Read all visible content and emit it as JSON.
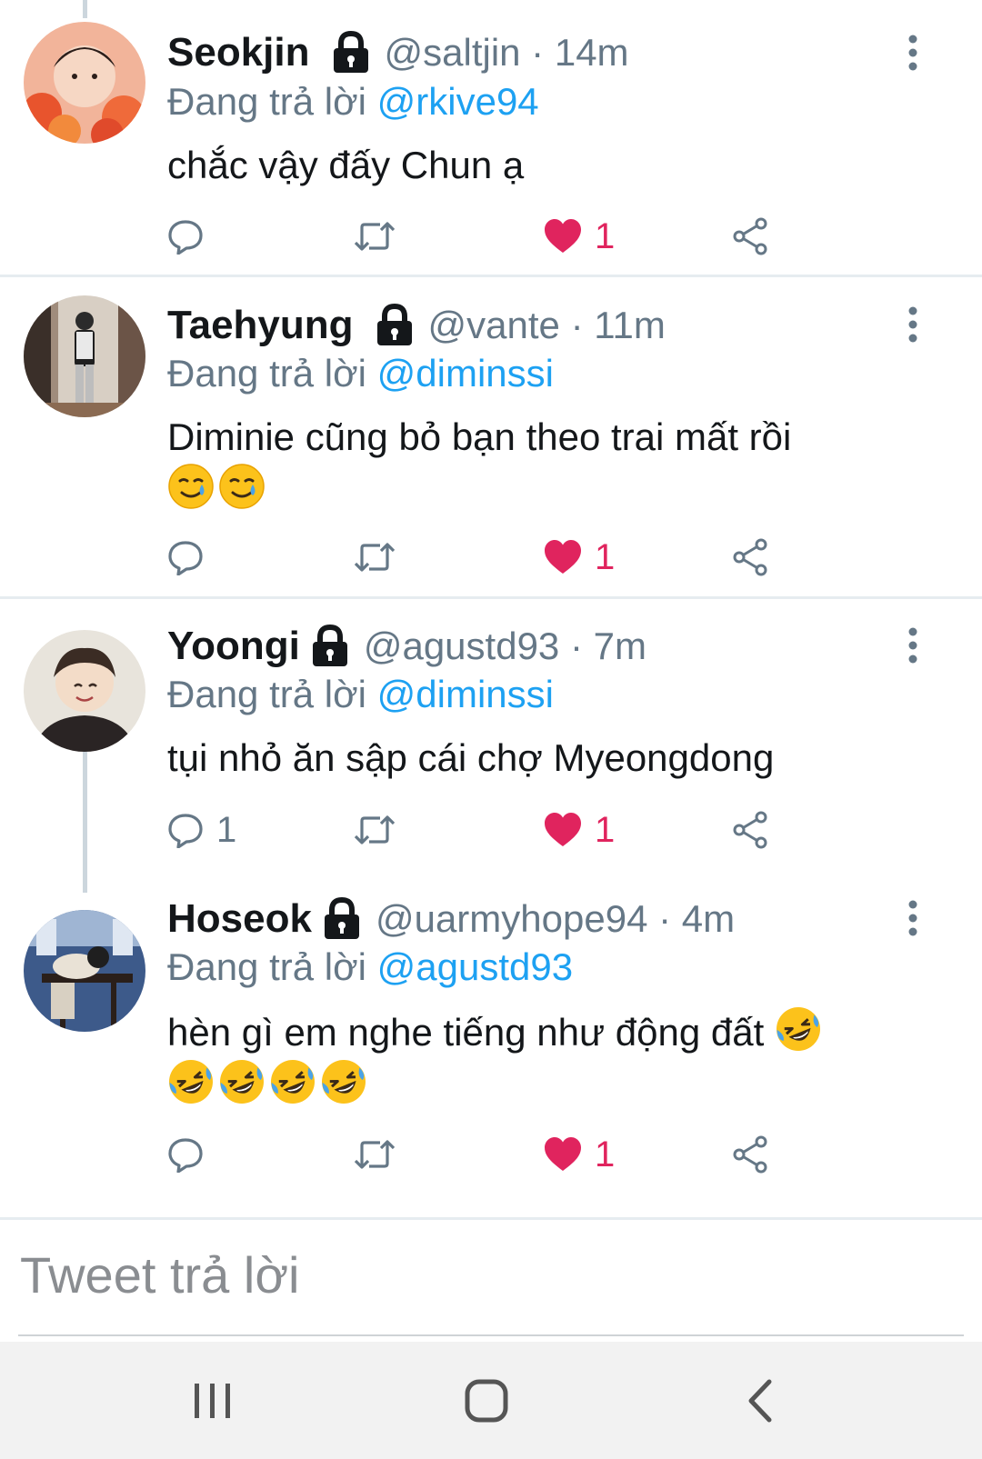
{
  "tweets": [
    {
      "name": "Seokjin",
      "handle": "@saltjin · 14m",
      "replying_prefix": "Đang trả lời",
      "replying_to": "@rkive94",
      "text": "chắc vậy đấy Chun ạ",
      "emojis": [],
      "reply_count": "",
      "like_count": "1"
    },
    {
      "name": "Taehyung",
      "handle": "@vante · 11m",
      "replying_prefix": "Đang trả lời",
      "replying_to": "@diminssi",
      "text": "Diminie cũng bỏ bạn theo trai mất rồi",
      "emojis": [
        "smiling-face-with-tear",
        "smiling-face-with-tear"
      ],
      "reply_count": "",
      "like_count": "1"
    },
    {
      "name": "Yoongi",
      "handle": "@agustd93 · 7m",
      "replying_prefix": "Đang trả lời",
      "replying_to": "@diminssi",
      "text": "tụi nhỏ ăn sập cái chợ Myeongdong",
      "emojis": [],
      "reply_count": "1",
      "like_count": "1"
    },
    {
      "name": "Hoseok",
      "handle": "@uarmyhope94 · 4m",
      "replying_prefix": "Đang trả lời",
      "replying_to": "@agustd93",
      "text": "hèn gì em nghe tiếng như động đất",
      "emojis": [
        "rolling-on-floor-laughing",
        "rolling-on-floor-laughing",
        "rolling-on-floor-laughing",
        "rolling-on-floor-laughing",
        "rolling-on-floor-laughing"
      ],
      "reply_count": "",
      "like_count": "1"
    }
  ],
  "reply_box": {
    "placeholder": "Tweet trả lời"
  },
  "icons": {
    "lock": "lock-icon",
    "more": "more-vertical-icon",
    "reply": "reply-icon",
    "retweet": "retweet-icon",
    "like": "heart-icon",
    "share": "share-icon"
  },
  "colors": {
    "mention": "#1da1f2",
    "like": "#e0245e",
    "secondary_text": "#657786",
    "action_icon": "#657786",
    "divider": "#e6ecf0",
    "nav_bar": "#f2f2f2"
  },
  "nav_bar": [
    "recent-apps-icon",
    "home-icon",
    "back-icon"
  ]
}
